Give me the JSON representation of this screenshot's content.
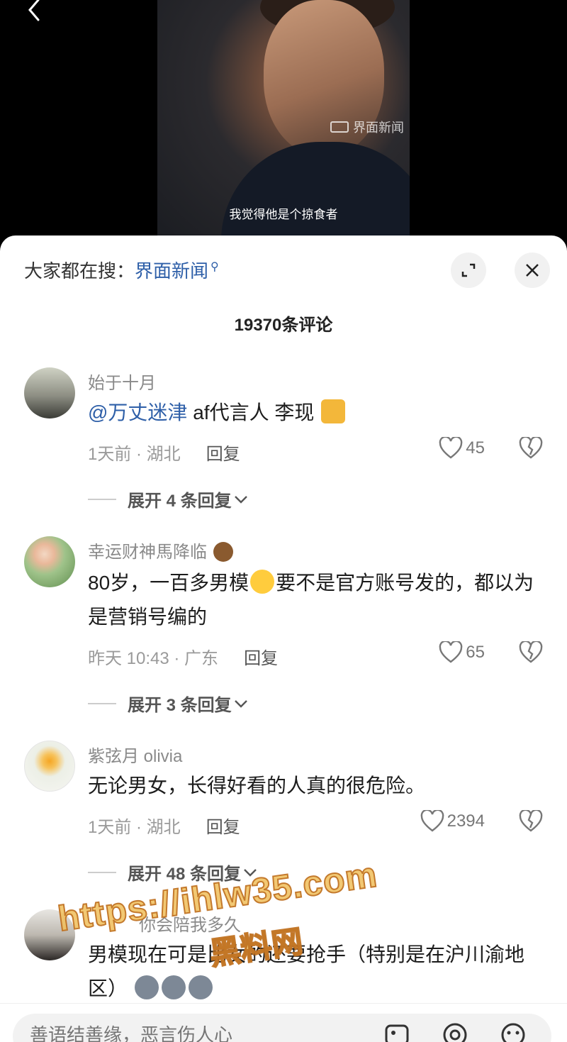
{
  "video": {
    "watermark": "界面新闻",
    "subtitle": "我觉得他是个掠食者"
  },
  "sheet": {
    "search_prefix": "大家都在搜：",
    "search_term": "界面新闻",
    "comment_count": "19370条评论"
  },
  "comments": [
    {
      "username": "始于十月",
      "mention": "@万丈迷津",
      "text": " af代言人 李现",
      "time_location": "1天前 · 湖北",
      "reply_label": "回复",
      "likes": "45",
      "expand_replies": "展开 4 条回复"
    },
    {
      "username": "幸运财神馬降临",
      "text_a": "80岁，一百多男模",
      "text_b": "要不是官方账号发的，都以为是营销号编的",
      "time_location": "昨天 10:43 · 广东",
      "reply_label": "回复",
      "likes": "65",
      "expand_replies": "展开 3 条回复"
    },
    {
      "username": "紫弦月 olivia",
      "text": "无论男女，长得好看的人真的很危险。",
      "time_location": "1天前 · 湖北",
      "reply_label": "回复",
      "likes": "2394",
      "expand_replies": "展开 48 条回复"
    },
    {
      "username": "你会陪我多久",
      "text": "男模现在可是比女的还要抢手（特别是在沪川渝地区）"
    }
  ],
  "input": {
    "placeholder": "善语结善缘，恶言伤人心"
  },
  "site_watermark": {
    "url": "https://ihlw35.com",
    "name": "黑料网"
  },
  "colors": {
    "link": "#2e5fa8",
    "muted": "#8a8a8a",
    "watermark_fill": "#f0be5a"
  }
}
